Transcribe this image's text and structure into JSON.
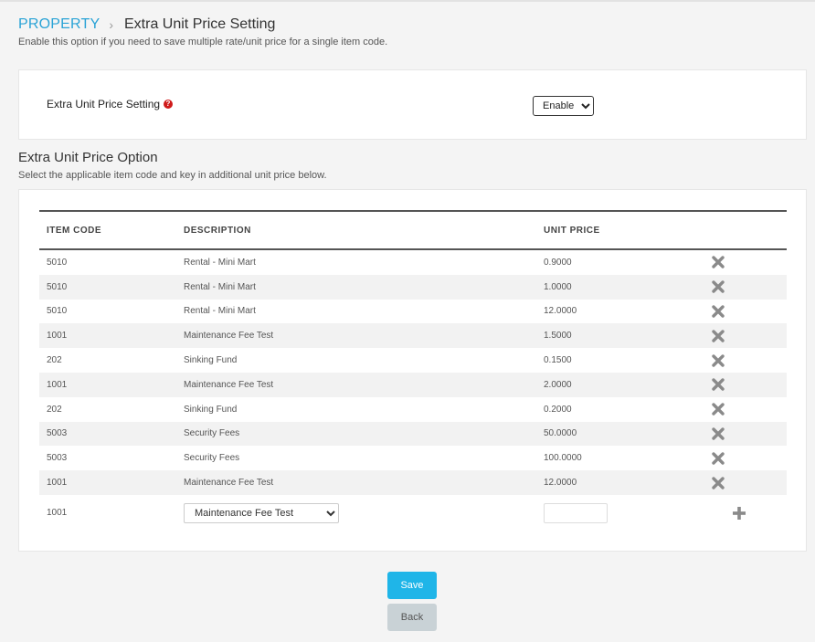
{
  "breadcrumb": {
    "parent": "PROPERTY",
    "separator": "›",
    "current": "Extra Unit Price Setting"
  },
  "subtitle": "Enable this option if you need to save multiple rate/unit price for a single item code.",
  "setting": {
    "label": "Extra Unit Price Setting",
    "help_icon": "question-icon",
    "value": "Enable",
    "options": [
      "Enable"
    ]
  },
  "section": {
    "title": "Extra Unit Price Option",
    "subtitle": "Select the applicable item code and key in additional unit price below."
  },
  "table": {
    "headers": {
      "item_code": "ITEM CODE",
      "description": "DESCRIPTION",
      "unit_price": "UNIT PRICE"
    },
    "rows": [
      {
        "code": "5010",
        "desc": "Rental - Mini Mart",
        "price": "0.9000"
      },
      {
        "code": "5010",
        "desc": "Rental - Mini Mart",
        "price": "1.0000"
      },
      {
        "code": "5010",
        "desc": "Rental - Mini Mart",
        "price": "12.0000"
      },
      {
        "code": "1001",
        "desc": "Maintenance Fee Test",
        "price": "1.5000"
      },
      {
        "code": "202",
        "desc": "Sinking Fund",
        "price": "0.1500"
      },
      {
        "code": "1001",
        "desc": "Maintenance Fee Test",
        "price": "2.0000"
      },
      {
        "code": "202",
        "desc": "Sinking Fund",
        "price": "0.2000"
      },
      {
        "code": "5003",
        "desc": "Security Fees",
        "price": "50.0000"
      },
      {
        "code": "5003",
        "desc": "Security Fees",
        "price": "100.0000"
      },
      {
        "code": "1001",
        "desc": "Maintenance Fee Test",
        "price": "12.0000"
      }
    ],
    "delete_icon": "close-icon",
    "new_row": {
      "code": "1001",
      "selected_desc": "Maintenance Fee Test",
      "price_value": "",
      "add_icon": "plus-icon"
    }
  },
  "buttons": {
    "save": "Save",
    "back": "Back"
  },
  "colors": {
    "accent": "#1fb5e8",
    "link": "#2aa3d6",
    "help": "#cf1a1a",
    "back_button": "#c9d2d6"
  }
}
